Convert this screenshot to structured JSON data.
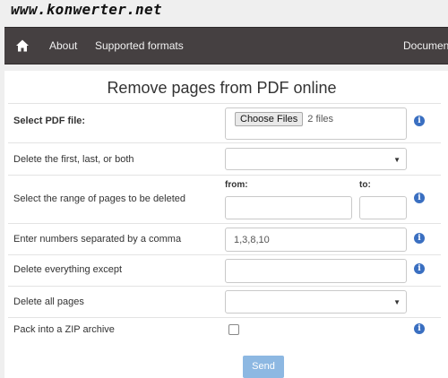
{
  "site": {
    "logo": "www.konwerter.net"
  },
  "nav": {
    "items": [
      {
        "label": "About"
      },
      {
        "label": "Supported formats"
      },
      {
        "label": "Document"
      }
    ]
  },
  "page": {
    "title": "Remove pages from PDF online"
  },
  "form": {
    "select_file": {
      "label": "Select PDF file:",
      "button": "Choose Files",
      "status": "2 files"
    },
    "delete_flb": {
      "label": "Delete the first, last, or both",
      "value": ""
    },
    "range": {
      "label": "Select the range of pages to be deleted",
      "from_label": "from:",
      "to_label": "to:",
      "from": "",
      "to": ""
    },
    "numbers": {
      "label": "Enter numbers separated by a comma",
      "value": "1,3,8,10"
    },
    "except": {
      "label": "Delete everything except",
      "value": ""
    },
    "delete_all": {
      "label": "Delete all pages",
      "value": ""
    },
    "zip": {
      "label": "Pack into a ZIP archive",
      "checked": false
    },
    "send": "Send"
  },
  "colors": {
    "navbar": "#454041",
    "info": "#3a6fc1",
    "send": "#8db8e2"
  },
  "icons": {
    "home": "home-icon",
    "info": "info-icon",
    "dropdown": "chevron-down-icon"
  }
}
